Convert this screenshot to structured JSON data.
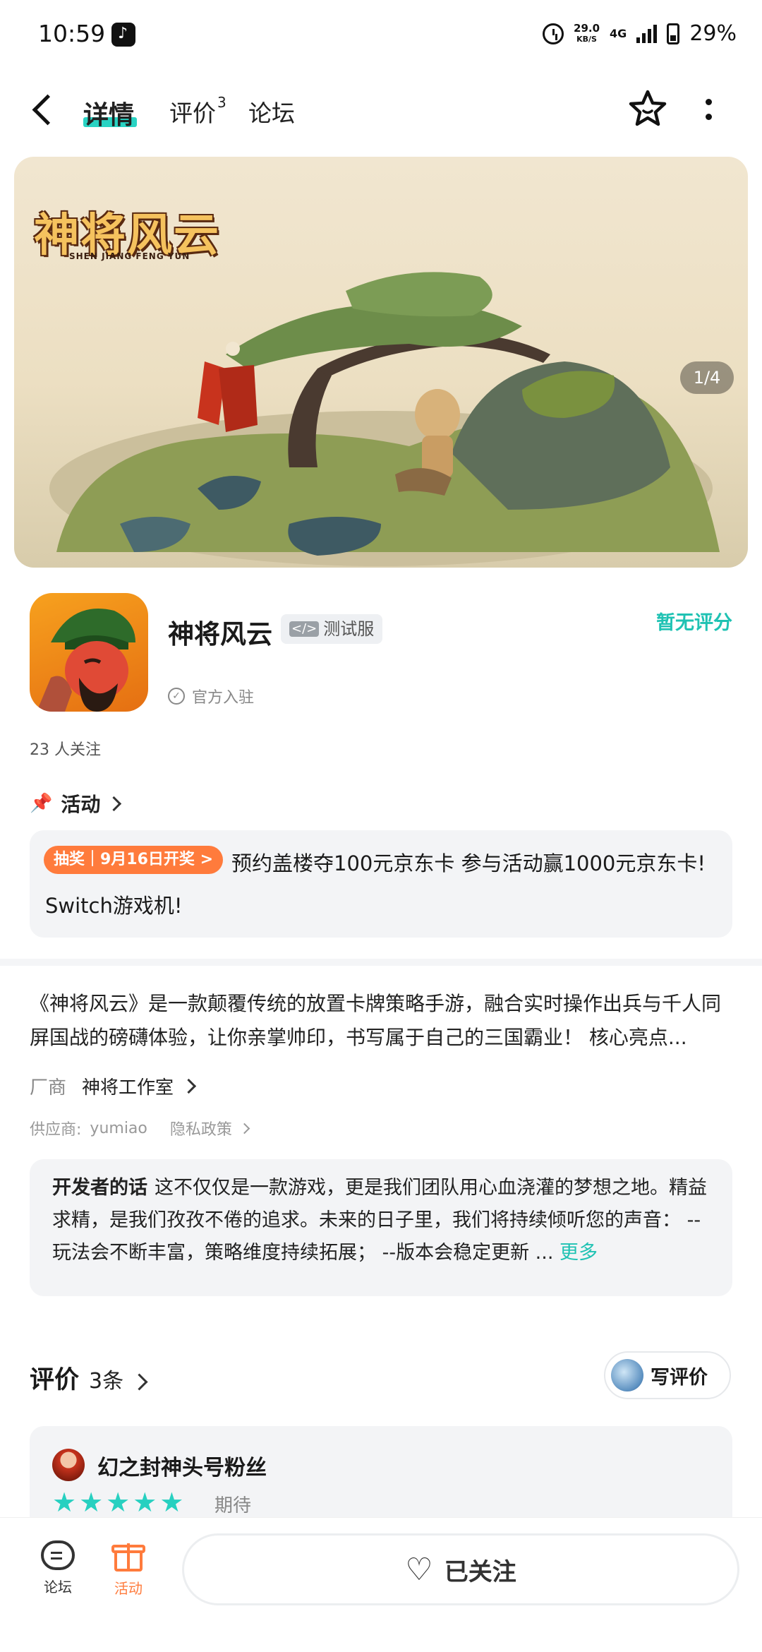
{
  "status_bar": {
    "time": "10:59",
    "net_speed_value": "29.0",
    "net_speed_unit": "KB/S",
    "network_type": "4G",
    "battery": "29%",
    "icons": [
      "tiktok-icon",
      "alarm-icon",
      "signal-icon",
      "battery-icon"
    ]
  },
  "header": {
    "tabs": [
      {
        "label": "详情",
        "active": true
      },
      {
        "label": "评价",
        "badge": "3"
      },
      {
        "label": "论坛"
      }
    ],
    "icons": [
      "back-icon",
      "star-icon",
      "more-icon"
    ]
  },
  "banner": {
    "logo_text": "神将风云",
    "logo_subtitle": "SHEN JIANG FENG YUN",
    "pager": "1/4"
  },
  "app": {
    "name": "神将风云",
    "badge": "测试服",
    "rating": "暂无评分",
    "official": "官方入驻",
    "followers": "23 人关注"
  },
  "activity": {
    "header": "活动",
    "tag": "抽奖｜9月16日开奖 >",
    "line1": "预约盖楼夺100元京东卡 参与活动赢1000元京东卡!",
    "line2": "Switch游戏机!"
  },
  "description": {
    "text": "《神将风云》是一款颠覆传统的放置卡牌策略手游，融合实时操作出兵与千人同屏国战的磅礴体验，让你亲掌帅印，书写属于自己的三国霸业！ 核心亮点..."
  },
  "vendor": {
    "label": "厂商",
    "value": "神将工作室",
    "supplier_label": "供应商:",
    "supplier_value": "yumiao",
    "privacy": "隐私政策"
  },
  "developer": {
    "label": "开发者的话",
    "text": "这不仅仅是一款游戏，更是我们团队用心血浇灌的梦想之地。精益求精，是我们孜孜不倦的追求。未来的日子里，我们将持续倾听您的声音： --玩法会不断丰富，策略维度持续拓展； --版本会稳定更新 ...",
    "more": "更多"
  },
  "reviews": {
    "title": "评价",
    "count": "3条",
    "write": "写评价",
    "items": [
      {
        "user": "幻之封神头号粉丝",
        "stars": 5,
        "tag": "期待"
      }
    ]
  },
  "bottom_bar": {
    "forum": "论坛",
    "activity": "活动",
    "follow": "已关注"
  },
  "colors": {
    "accent_teal": "#1fc2b3",
    "accent_orange": "#ff7b3c"
  }
}
